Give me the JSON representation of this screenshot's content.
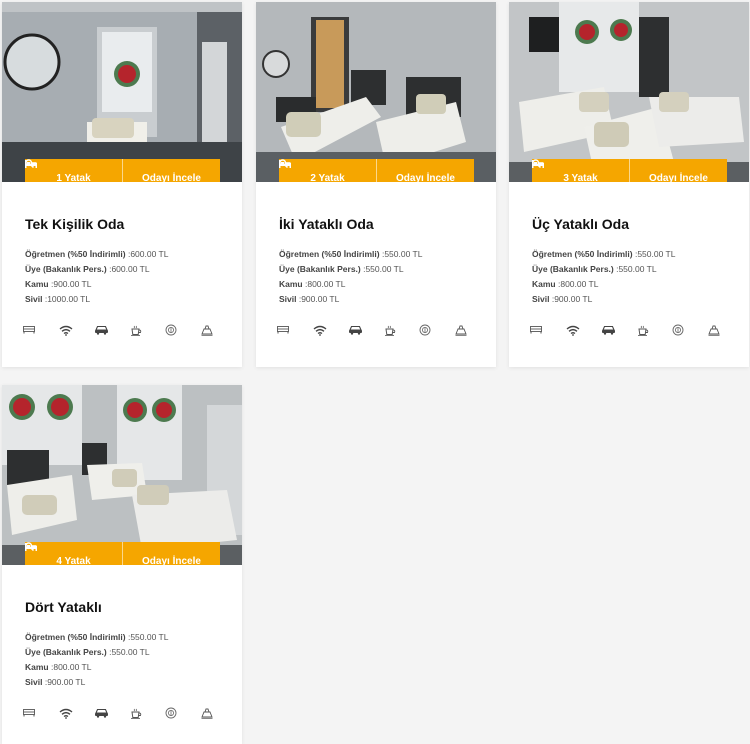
{
  "colors": {
    "accent": "#f5a600",
    "card_bg": "#ffffff",
    "page_bg": "#f4f4f4"
  },
  "rooms": [
    {
      "bed_label": "1 Yatak",
      "view_label": "Odayı İncele",
      "title": "Tek Kişilik Oda",
      "prices": [
        {
          "label": "Öğretmen (%50 İndirimli)",
          "value": " :600.00 TL"
        },
        {
          "label": "Üye (Bakanlık Pers.)",
          "value": " :600.00 TL"
        },
        {
          "label": "Kamu",
          "value": " :900.00 TL"
        },
        {
          "label": "Sivil",
          "value": " :1000.00 TL"
        }
      ]
    },
    {
      "bed_label": "2 Yatak",
      "view_label": "Odayı İncele",
      "title": "İki Yataklı Oda",
      "prices": [
        {
          "label": "Öğretmen (%50 İndirimli)",
          "value": " :550.00 TL"
        },
        {
          "label": "Üye (Bakanlık Pers.)",
          "value": " :550.00 TL"
        },
        {
          "label": "Kamu",
          "value": " :800.00 TL"
        },
        {
          "label": "Sivil",
          "value": " :900.00 TL"
        }
      ]
    },
    {
      "bed_label": "3 Yatak",
      "view_label": "Odayı İncele",
      "title": "Üç Yataklı Oda",
      "prices": [
        {
          "label": "Öğretmen (%50 İndirimli)",
          "value": " :550.00 TL"
        },
        {
          "label": "Üye (Bakanlık Pers.)",
          "value": " :550.00 TL"
        },
        {
          "label": "Kamu",
          "value": " :800.00 TL"
        },
        {
          "label": "Sivil",
          "value": " :900.00 TL"
        }
      ]
    },
    {
      "bed_label": "4 Yatak",
      "view_label": "Odayı İncele",
      "title": "Dört Yataklı",
      "prices": [
        {
          "label": "Öğretmen (%50 İndirimli)",
          "value": " :550.00 TL"
        },
        {
          "label": "Üye (Bakanlık Pers.)",
          "value": " :550.00 TL"
        },
        {
          "label": "Kamu",
          "value": " :800.00 TL"
        },
        {
          "label": "Sivil",
          "value": " :900.00 TL"
        }
      ]
    }
  ],
  "amenity_icons": [
    "bed-icon",
    "wifi-icon",
    "car-icon",
    "coffee-icon",
    "hairdryer-icon",
    "iron-icon"
  ]
}
